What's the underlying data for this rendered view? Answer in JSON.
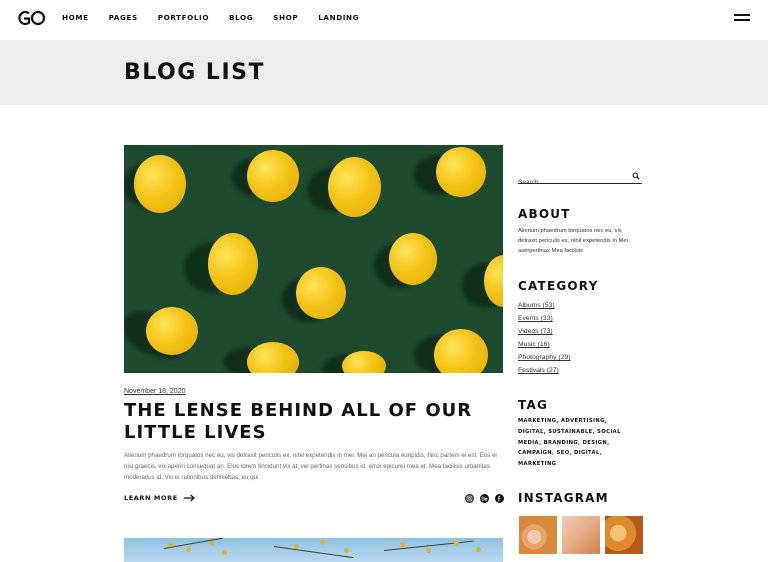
{
  "header": {
    "logo_text": "GO",
    "nav": [
      "HOME",
      "PAGES",
      "PORTFOLIO",
      "BLOG",
      "SHOP",
      "LANDING"
    ]
  },
  "page_title": "BLOG LIST",
  "post": {
    "date": "November 18, 2020",
    "title": "THE LENSE BEHIND ALL OF OUR LITTLE LIVES",
    "excerpt": "Alienum phaedrum torquatos nec eu, vis detraxit periculis ex, nihil expetendis in mei. Mei an pericula euripidis, hinc partem ei est. Eos ei nisl graecis, vix aperiri consequat an. Eius lorem tincidunt vix at, vel pertinax sensibus id, error epicurei mea et. Mea facilisis urbanitas moderatius id. Vis ei rationibus definiebas, eu qui.",
    "learn_more": "LEARN MORE",
    "share_icons": [
      "instagram-icon",
      "behance-icon",
      "facebook-icon"
    ]
  },
  "sidebar": {
    "search_placeholder": "Search",
    "about": {
      "title": "ABOUT",
      "text": "Alienum phaedrum torquatos nec eu, vis detraxit periculis ex, nihil expetendis in Mei aserpertinax Mea facilisis"
    },
    "category": {
      "title": "CATEGORY",
      "items": [
        "Albums (53)",
        "Events (33)",
        "Videos (73)",
        "Music (16)",
        "Photography (29)",
        "Festivals (27)"
      ]
    },
    "tag": {
      "title": "TAG",
      "items": [
        "MARKETING",
        "ADVERTISING",
        "DIGITAL",
        "SUSTAINABLE",
        "SOCIAL MEDIA",
        "BRANDING",
        "DESIGN",
        "CAMPAIGN",
        "SEO",
        "DIGITAL",
        "MARKETING"
      ]
    },
    "instagram": {
      "title": "INSTAGRAM"
    }
  },
  "colors": {
    "band_background": "#eeeced",
    "image_green": "#1e4a2d",
    "lemon_yellow": "#f4c317",
    "text_dark": "#111111"
  }
}
